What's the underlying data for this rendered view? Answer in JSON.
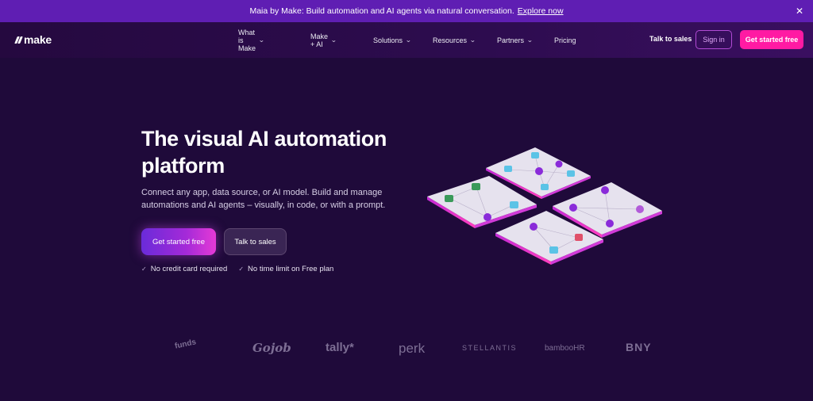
{
  "banner": {
    "text": "Maia by Make: Build automation and AI agents via natural conversation.",
    "link": "Explore now",
    "close_icon": "close-icon"
  },
  "nav": {
    "logo": "make",
    "menu": [
      {
        "label": "What is Make",
        "has_dropdown": true
      },
      {
        "label": "Make + AI",
        "has_dropdown": true
      },
      {
        "label": "Solutions",
        "has_dropdown": true
      },
      {
        "label": "Resources",
        "has_dropdown": true
      },
      {
        "label": "Partners",
        "has_dropdown": true
      },
      {
        "label": "Pricing",
        "has_dropdown": false
      }
    ],
    "talk_to_sales": "Talk to sales",
    "sign_in": "Sign in",
    "get_started": "Get started free"
  },
  "hero": {
    "title_line1": "The visual AI automation",
    "title_line2": "platform",
    "subtitle": "Connect any app, data source, or AI model. Build and manage automations and AI agents – visually, in code, or with a prompt.",
    "primary_cta": "Get started free",
    "secondary_cta": "Talk to sales",
    "checks": [
      "No credit card required",
      "No time limit on Free plan"
    ]
  },
  "trusted_logos": [
    "funds",
    "Gojob",
    "tally*",
    "perk",
    "STELLANTIS",
    "bambooHR",
    "BNY"
  ],
  "colors": {
    "background": "#1f0a3a",
    "banner": "#5f1eb3",
    "accent_pink": "#ff1aa3",
    "accent_purple": "#a42ad8"
  }
}
